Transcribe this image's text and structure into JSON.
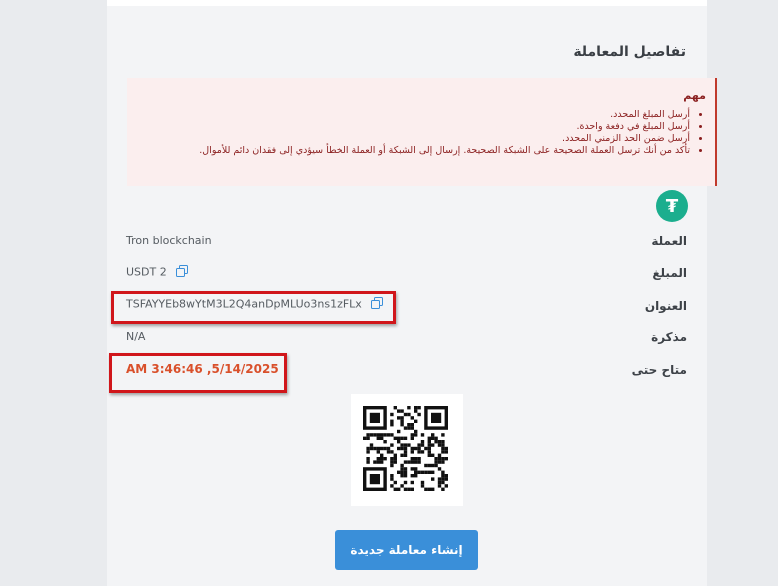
{
  "panel": {
    "title": "تفاصيل المعاملة"
  },
  "alert": {
    "title": "مهم",
    "items": [
      "أرسل المبلغ المحدد.",
      "أرسل المبلغ في دفعة واحدة.",
      "أرسل ضمن الحد الزمني المحدد.",
      "تأكد من أنك ترسل العملة الصحيحة على الشبكة الصحيحة. إرسال إلى الشبكة أو العملة الخطأ سيؤدي إلى فقدان دائم للأموال."
    ]
  },
  "details": {
    "currency_label": "العملة",
    "currency_value": "Tron blockchain",
    "amount_label": "المبلغ",
    "amount_value": "USDT 2",
    "address_label": "العنوان",
    "address_value": "TSFAYYEb8wYtM3L2Q4anDpMLUo3ns1zFLx",
    "memo_label": "مذكرة",
    "memo_value": "N/A",
    "available_label": "متاح حتى",
    "available_value": "AM 3:46:46 ,5/14/2025"
  },
  "button": {
    "new_transaction": "إنشاء معاملة جديدة"
  },
  "colors": {
    "accent": "#3a8fd9",
    "alert": "#c0392b",
    "highlight": "#d0161b",
    "tether": "#1bae8e"
  },
  "icons": [
    "usdt-logo-icon",
    "copy-icon",
    "qr-code"
  ]
}
